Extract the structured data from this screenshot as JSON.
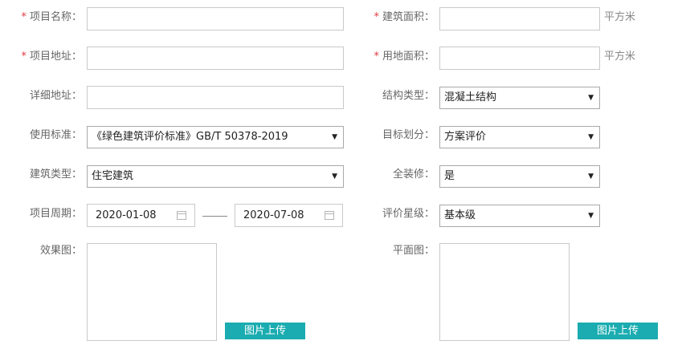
{
  "form": {
    "project_name": {
      "label": "项目名称：",
      "value": ""
    },
    "building_area": {
      "label": "建筑面积：",
      "value": "",
      "unit": "平方米"
    },
    "project_address": {
      "label": "项目地址：",
      "value": ""
    },
    "land_area": {
      "label": "用地面积：",
      "value": "",
      "unit": "平方米"
    },
    "detail_address": {
      "label": "详细地址：",
      "value": ""
    },
    "structure_type": {
      "label": "结构类型：",
      "value": "混凝土结构"
    },
    "standard": {
      "label": "使用标准：",
      "value": "《绿色建筑评价标准》GB/T 50378-2019"
    },
    "target": {
      "label": "目标划分：",
      "value": "方案评价"
    },
    "building_type": {
      "label": "建筑类型：",
      "value": "住宅建筑"
    },
    "full_decoration": {
      "label": "全装修：",
      "value": "是"
    },
    "project_period": {
      "label": "项目周期：",
      "start": "2020-01-08",
      "end": "2020-07-08"
    },
    "rating_level": {
      "label": "评价星级：",
      "value": "基本级"
    },
    "effect_image": {
      "label": "效果图：",
      "upload_label": "图片上传"
    },
    "plan_image": {
      "label": "平面图：",
      "upload_label": "图片上传"
    },
    "required_mark": "*"
  },
  "icons": {
    "select_arrow": "▼",
    "calendar": "calendar-icon"
  },
  "colors": {
    "required": "#e0383e",
    "upload_button": "#1aacb0"
  }
}
